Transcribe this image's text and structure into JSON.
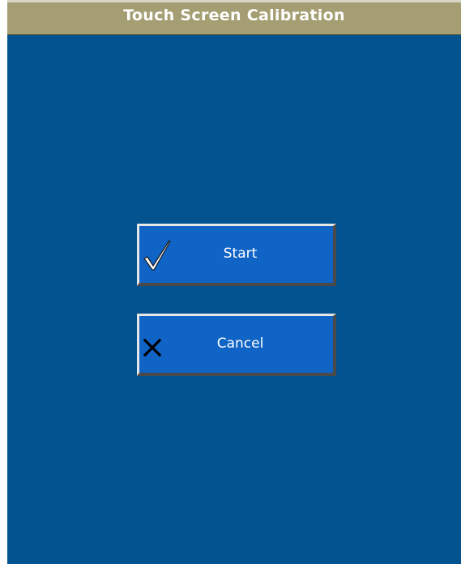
{
  "window": {
    "title": "Touch Screen Calibration",
    "background_color": "#02538f",
    "titlebar_color": "#a59e73"
  },
  "buttons": {
    "start": {
      "label": "Start",
      "icon": "checkmark-icon"
    },
    "cancel": {
      "label": "Cancel",
      "icon": "x-icon"
    }
  },
  "colors": {
    "button_face": "#0f64c6",
    "button_text": "#ffffff"
  }
}
